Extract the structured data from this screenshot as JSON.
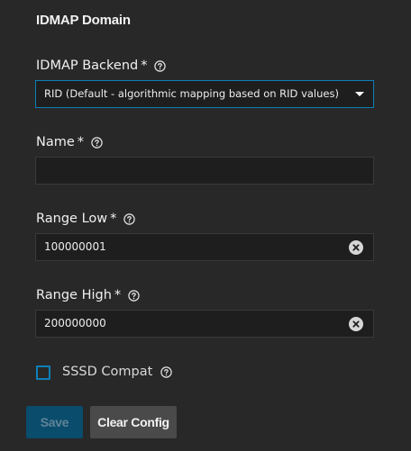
{
  "section": {
    "title": "IDMAP Domain"
  },
  "fields": {
    "backend": {
      "label": "IDMAP Backend",
      "required_mark": "*",
      "value": "RID (Default - algorithmic mapping based on RID values)"
    },
    "name": {
      "label": "Name",
      "required_mark": "*",
      "value": ""
    },
    "range_low": {
      "label": "Range Low",
      "required_mark": "*",
      "value": "100000001"
    },
    "range_high": {
      "label": "Range High",
      "required_mark": "*",
      "value": "200000000"
    }
  },
  "sssd_compat": {
    "label": "SSSD Compat",
    "checked": false
  },
  "buttons": {
    "save": "Save",
    "clear_config": "Clear Config"
  },
  "icons": {
    "help": "help-circle-icon",
    "clear": "clear-circle-icon",
    "dropdown": "chevron-down-icon"
  },
  "colors": {
    "background": "#282828",
    "input_background": "#1e1e1e",
    "accent": "#0d7fb8",
    "save_button": "#0a4c6c",
    "clear_button": "#4a4a4a"
  }
}
